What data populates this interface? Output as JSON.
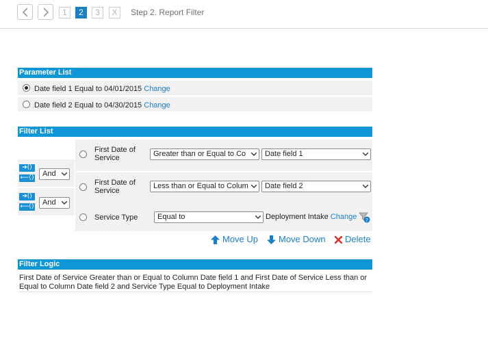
{
  "wizard": {
    "steps": [
      "1",
      "2",
      "3",
      "X"
    ],
    "active_step": "2",
    "title": "Step 2. Report Filter"
  },
  "parameter_list": {
    "header": "Parameter List",
    "items": [
      {
        "text": "Date field 1 Equal to 04/01/2015",
        "link": "Change",
        "selected": true
      },
      {
        "text": "Date field 2 Equal to 04/30/2015",
        "link": "Change",
        "selected": false
      }
    ]
  },
  "filter_list": {
    "header": "Filter List",
    "connectors": [
      {
        "icon_in": "indent-right-icon",
        "icon_out": "indent-left-icon",
        "value": "And"
      },
      {
        "icon_in": "indent-right-icon",
        "icon_out": "indent-left-icon",
        "value": "And"
      }
    ],
    "rows": [
      {
        "field_line1": "First Date of",
        "field_line2": "Service",
        "operator": "Greater than or Equal to Co",
        "value": "Date field 1"
      },
      {
        "field_line1": "First Date of",
        "field_line2": "Service",
        "operator": "Less than or Equal to Colum",
        "value": "Date field 2"
      },
      {
        "field_line1": "Service Type",
        "field_line2": "",
        "operator": "Equal to",
        "value_text": "Deployment Intake",
        "link": "Change"
      }
    ],
    "actions": {
      "move_up": "Move Up",
      "move_down": "Move Down",
      "delete": "Delete"
    }
  },
  "filter_logic": {
    "header": "Filter Logic",
    "text": "First Date of Service Greater than or Equal to Column Date field 1 and First Date of Service Less than or Equal to Column Date field 2 and Service Type Equal to Deployment Intake"
  },
  "colors": {
    "header_bg": "#0f96d9",
    "link": "#1a7fc6",
    "active_step": "#1a7fc6",
    "delete_icon": "#d9342b"
  }
}
